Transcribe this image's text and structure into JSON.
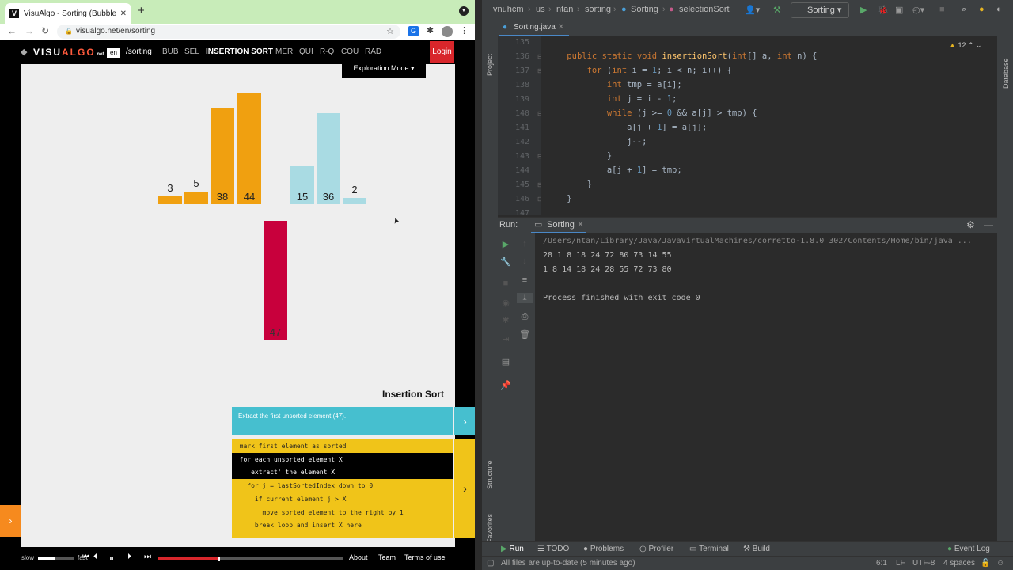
{
  "browser": {
    "tab_title": "VisuAlgo - Sorting (Bubble, Se",
    "favicon": "V",
    "url": "visualgo.net/en/sorting"
  },
  "visualgo": {
    "logo_main": "VISU",
    "logo_accent": "ALGO",
    "logo_suffix": ".net",
    "lang": "en",
    "path": "/sorting",
    "nav": [
      "BUB",
      "SEL",
      "INSERTION SORT",
      "MER",
      "QUI",
      "R-Q",
      "COU",
      "RAD"
    ],
    "active_nav": "INSERTION SORT",
    "login": "Login",
    "mode": "Exploration Mode",
    "bars": [
      {
        "label": "3",
        "value": 3,
        "color": "#f0a010"
      },
      {
        "label": "5",
        "value": 5,
        "color": "#f0a010"
      },
      {
        "label": "38",
        "value": 38,
        "color": "#f0a010"
      },
      {
        "label": "44",
        "value": 44,
        "color": "#f0a010"
      },
      {
        "label": "15",
        "value": 15,
        "color": "#a9dbe3"
      },
      {
        "label": "36",
        "value": 36,
        "color": "#a9dbe3"
      },
      {
        "label": "2",
        "value": 2,
        "color": "#a9dbe3"
      }
    ],
    "extracted": {
      "label": "47",
      "value": 47,
      "color": "#c8003c"
    },
    "algo_title": "Insertion Sort",
    "status": "Extract the first unsorted element (47).",
    "code": [
      {
        "text": "mark first element as sorted",
        "highlight": false
      },
      {
        "text": "for each unsorted element X",
        "highlight": true
      },
      {
        "text": "  'extract' the element X",
        "highlight": true
      },
      {
        "text": "  for j = lastSortedIndex down to 0",
        "highlight": false
      },
      {
        "text": "    if current element j > X",
        "highlight": false
      },
      {
        "text": "      move sorted element to the right by 1",
        "highlight": false
      },
      {
        "text": "    break loop and insert X here",
        "highlight": false
      }
    ],
    "footer": {
      "slow": "slow",
      "fast": "fast",
      "speed": 0.45,
      "progress": 0.32,
      "about": "About",
      "team": "Team",
      "terms": "Terms of use"
    }
  },
  "ide": {
    "breadcrumbs": [
      "vnuhcm",
      "us",
      "ntan",
      "sorting",
      "Sorting",
      "selectionSort"
    ],
    "run_config": "Sorting",
    "project_label": "Project",
    "database_label": "Database",
    "structure_label": "Structure",
    "favorites_label": "Favorites",
    "file_tab": "Sorting.java",
    "warnings": "12",
    "line_numbers": [
      "135",
      "136",
      "137",
      "138",
      "139",
      "140",
      "141",
      "142",
      "143",
      "144",
      "145",
      "146",
      "147"
    ],
    "code_lines": [
      "",
      "    public static void insertionSort(int[] a, int n) {",
      "        for (int i = 1; i < n; i++) {",
      "            int tmp = a[i];",
      "            int j = i - 1;",
      "            while (j >= 0 && a[j] > tmp) {",
      "                a[j + 1] = a[j];",
      "                j--;",
      "            }",
      "            a[j + 1] = tmp;",
      "        }",
      "    }",
      ""
    ],
    "run_label": "Run:",
    "run_tab": "Sorting",
    "console": [
      "/Users/ntan/Library/Java/JavaVirtualMachines/corretto-1.8.0_302/Contents/Home/bin/java ...",
      "28 1 8 18 24 72 80 73 14 55",
      "1 8 14 18 24 28 55 72 73 80",
      "",
      "Process finished with exit code 0"
    ],
    "bottom_tabs": [
      "Run",
      "TODO",
      "Problems",
      "Profiler",
      "Terminal",
      "Build"
    ],
    "event_log": "Event Log",
    "status_msg": "All files are up-to-date (5 minutes ago)",
    "position": "6:1",
    "line_sep": "LF",
    "encoding": "UTF-8",
    "indent": "4 spaces"
  }
}
